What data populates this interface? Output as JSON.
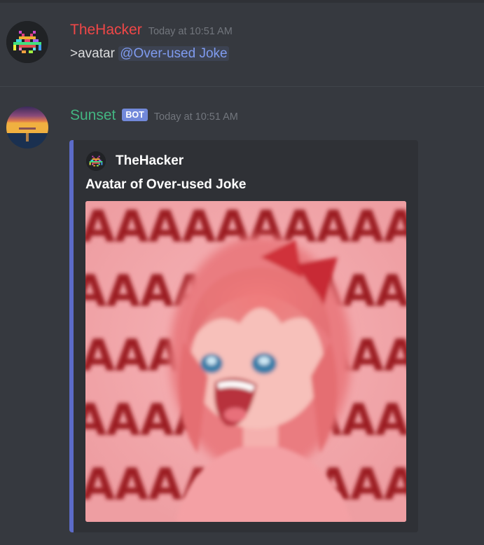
{
  "colors": {
    "background": "#36393f",
    "embed_background": "#2f3136",
    "embed_accent": "#5c6bc8",
    "thehacker_name": "#f04747",
    "sunset_name": "#43b581",
    "mention": "#7f9bf0",
    "timestamp": "#72767d",
    "bot_tag": "#7289da"
  },
  "messages": [
    {
      "author": "TheHacker",
      "timestamp": "Today at 10:51 AM",
      "avatar_icon": "space-invader-icon",
      "text_prefix": ">avatar ",
      "mention": "@Over-used Joke"
    },
    {
      "author": "Sunset",
      "bot_tag": "BOT",
      "timestamp": "Today at 10:51 AM",
      "avatar_icon": "sunset-avatar-icon",
      "embed": {
        "author_name": "TheHacker",
        "author_icon": "space-invader-icon",
        "title": "Avatar of Over-used Joke",
        "image": "screaming-anime-girl-avatar-image",
        "image_text": "AAAAAAAAAAAAAAAAAAAAAAAAAAAAAAAAAAAAAAAA"
      }
    }
  ]
}
